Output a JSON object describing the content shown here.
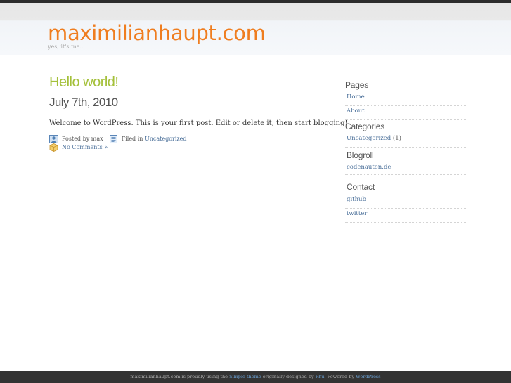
{
  "header": {
    "site_title": "maximilianhaupt.com",
    "tagline": "yes, it's me..."
  },
  "post": {
    "title": "Hello world!",
    "date": "July 7th, 2010",
    "body": "Welcome to WordPress. This is your first post. Edit or delete it, then start blogging!",
    "posted_by_label": "Posted by max",
    "filed_in_label": "Filed in",
    "category": "Uncategorized",
    "comments_link": "No Comments »"
  },
  "sidebar": {
    "pages": {
      "heading": "Pages",
      "items": [
        "Home",
        "About"
      ]
    },
    "categories": {
      "heading": "Categories",
      "items": [
        {
          "label": "Uncategorized",
          "count": "(1)"
        }
      ]
    },
    "blogroll": {
      "heading": "Blogroll",
      "items": [
        "codenauten.de"
      ]
    },
    "contact": {
      "heading": "Contact",
      "items": [
        "github",
        "twitter"
      ]
    }
  },
  "footer": {
    "text_1": "maximilianhaupt.com is proudly using the",
    "theme_link": "Simple theme",
    "text_2": "originally designed by",
    "designer_link": "Phu",
    "text_3": ". Powered by",
    "wp_link": "WordPress"
  },
  "colors": {
    "logo_orange": "#ef7d1f",
    "title_green": "#a4c03a",
    "link_blue": "#4a6f99",
    "footer_bg": "#333333"
  }
}
